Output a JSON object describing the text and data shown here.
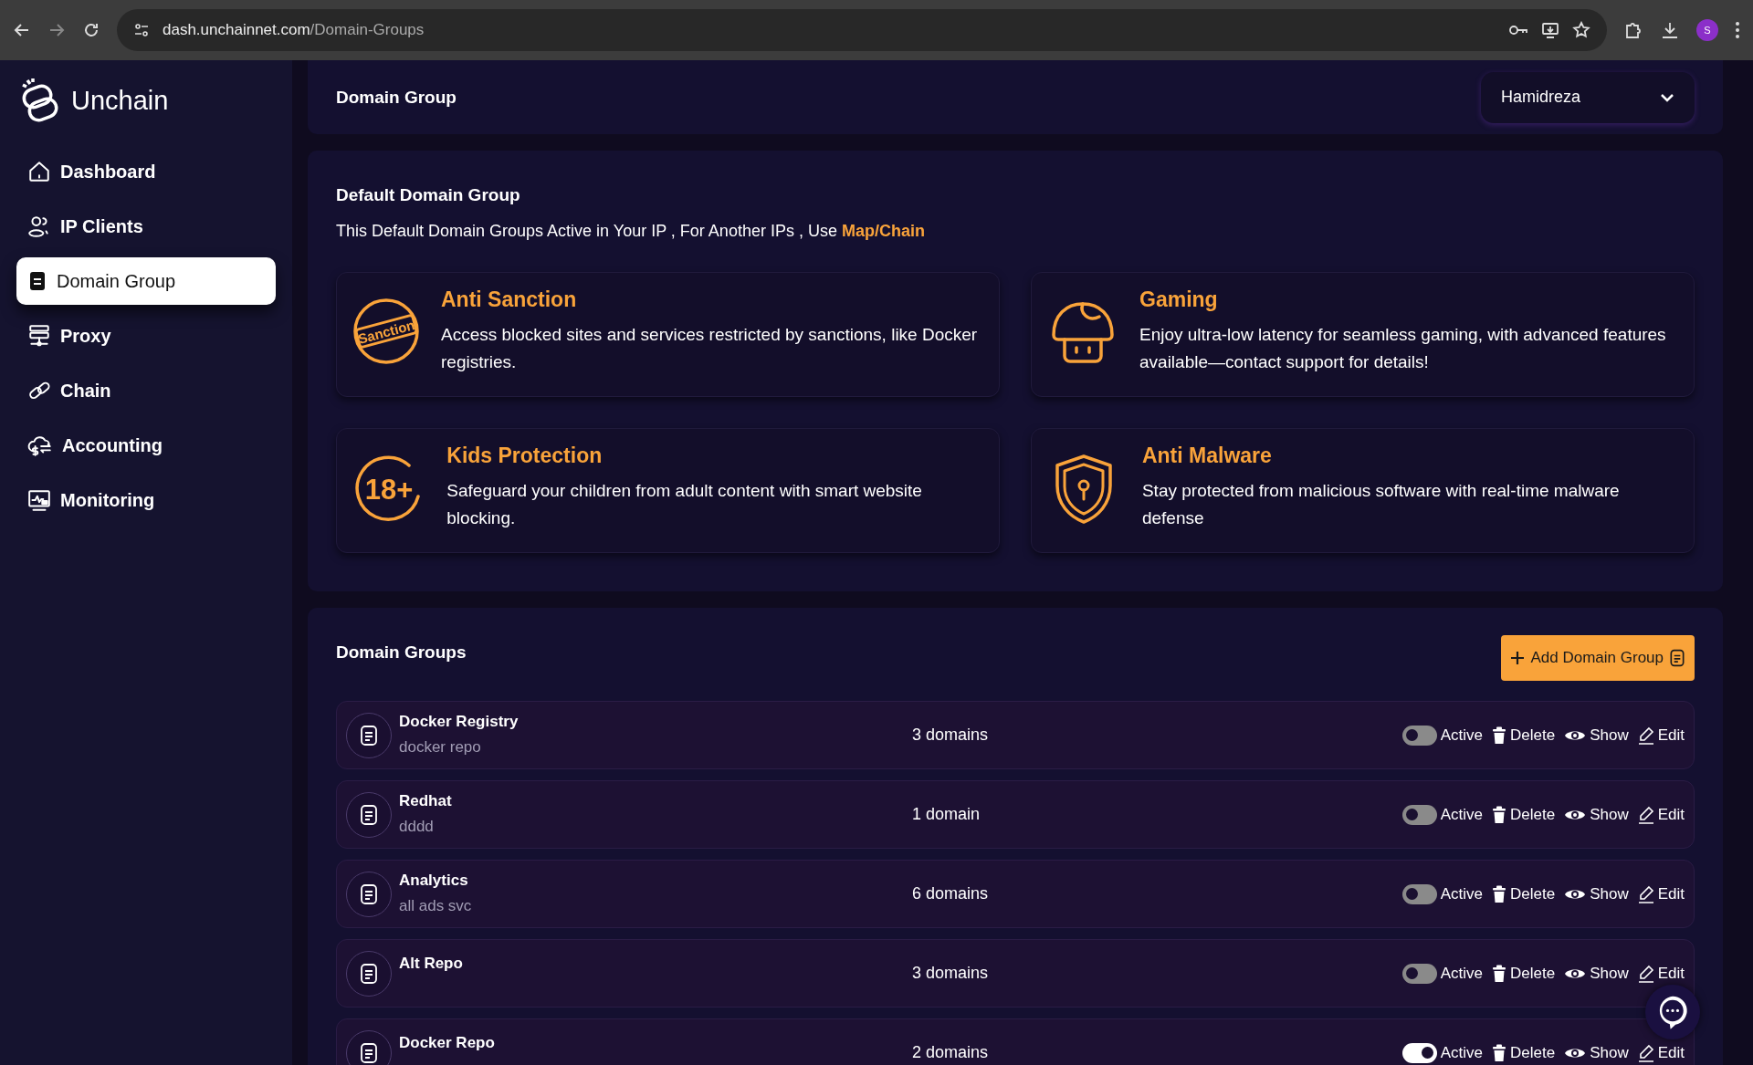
{
  "browser": {
    "url_host": "dash.unchainnet.com",
    "url_path": "/Domain-Groups",
    "avatar": "S"
  },
  "sidebar": {
    "brand": "Unchain",
    "items": [
      {
        "label": "Dashboard",
        "selected": false
      },
      {
        "label": "IP Clients",
        "selected": false
      },
      {
        "label": "Domain Group",
        "selected": true
      },
      {
        "label": "Proxy",
        "selected": false
      },
      {
        "label": "Chain",
        "selected": false
      },
      {
        "label": "Accounting",
        "selected": false
      },
      {
        "label": "Monitoring",
        "selected": false
      }
    ]
  },
  "header": {
    "title": "Domain Group",
    "user": "Hamidreza"
  },
  "default_group": {
    "title": "Default Domain Group",
    "description": "This Default Domain Groups Active in Your IP , For Another IPs , Use ",
    "link": "Map/Chain",
    "features": [
      {
        "title": "Anti Sanction",
        "description": "Access blocked sites and services restricted by sanctions, like Docker registries.",
        "icon_text": "Sanction"
      },
      {
        "title": "Gaming",
        "description": "Enjoy ultra-low latency for seamless gaming, with advanced features available—contact support for details!"
      },
      {
        "title": "Kids Protection",
        "description": "Safeguard your children from adult content with smart website blocking.",
        "icon_text": "18+"
      },
      {
        "title": "Anti Malware",
        "description": "Stay protected from malicious software with real-time malware defense"
      }
    ]
  },
  "groups": {
    "title": "Domain Groups",
    "add_button": "Add Domain Group",
    "rows": [
      {
        "name": "Docker Registry",
        "description": "docker repo",
        "count": "3 domains",
        "active": false,
        "active_label": "Active",
        "delete": "Delete",
        "show": "Show",
        "edit": "Edit"
      },
      {
        "name": "Redhat",
        "description": "dddd",
        "count": "1 domain",
        "active": false,
        "active_label": "Active",
        "delete": "Delete",
        "show": "Show",
        "edit": "Edit"
      },
      {
        "name": "Analytics",
        "description": "all ads svc",
        "count": "6 domains",
        "active": false,
        "active_label": "Active",
        "delete": "Delete",
        "show": "Show",
        "edit": "Edit"
      },
      {
        "name": "Alt Repo",
        "count": "3 domains",
        "active": false,
        "active_label": "Active",
        "delete": "Delete",
        "show": "Show",
        "edit": "Edit"
      },
      {
        "name": "Docker Repo",
        "count": "2 domains",
        "active": true,
        "active_label": "Active",
        "delete": "Delete",
        "show": "Show",
        "edit": "Edit"
      }
    ]
  }
}
